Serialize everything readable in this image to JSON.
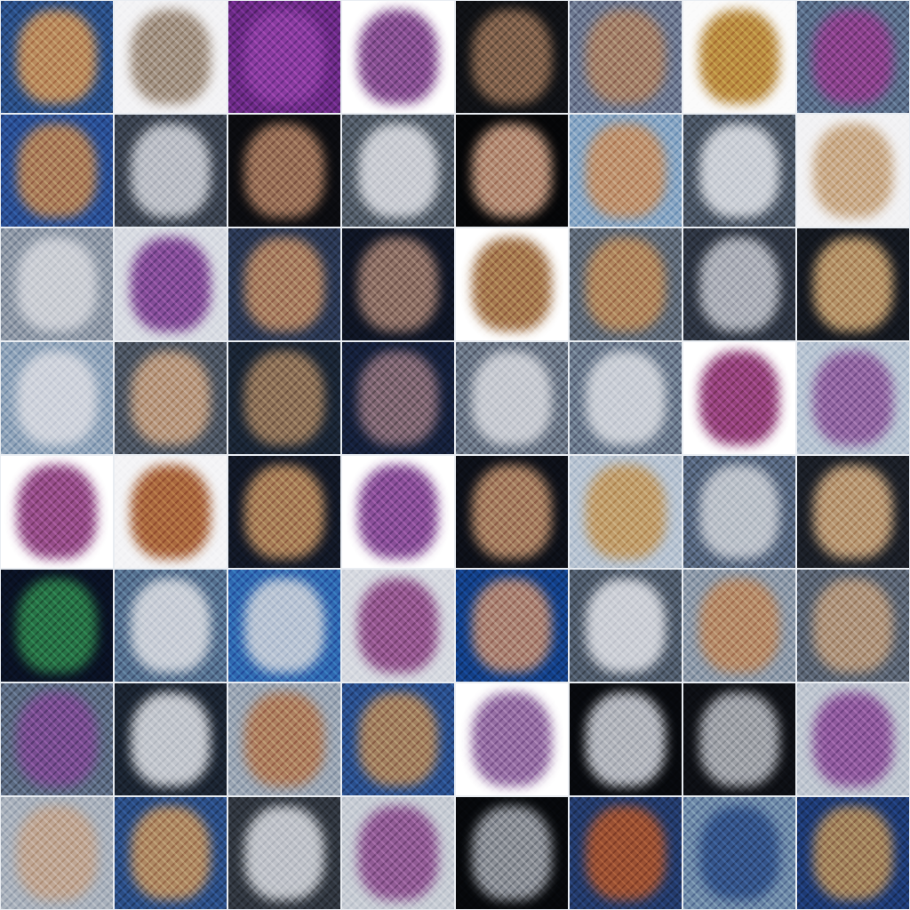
{
  "grid": {
    "rows": 8,
    "cols": 8,
    "tiles": [
      {
        "bg": "#2b4f86",
        "blob": "#c9925a"
      },
      {
        "bg": "#f3f3f5",
        "blob": "#9a8877"
      },
      {
        "bg": "#6a2a84",
        "blob": "#8d3fa3"
      },
      {
        "bg": "#ffffff",
        "blob": "#7a3e86"
      },
      {
        "bg": "#101216",
        "blob": "#8c6a52"
      },
      {
        "bg": "#6d7890",
        "blob": "#a98266"
      },
      {
        "bg": "#fbfbfb",
        "blob": "#b4822f"
      },
      {
        "bg": "#5b6f8a",
        "blob": "#8e3e8c"
      },
      {
        "bg": "#2a4f93",
        "blob": "#b88455"
      },
      {
        "bg": "#3b4350",
        "blob": "#c9ccd3"
      },
      {
        "bg": "#0b0c10",
        "blob": "#a77a5f"
      },
      {
        "bg": "#525c68",
        "blob": "#d7d9df"
      },
      {
        "bg": "#050608",
        "blob": "#c59a80"
      },
      {
        "bg": "#87a5c3",
        "blob": "#c49268"
      },
      {
        "bg": "#4a5564",
        "blob": "#dadde3"
      },
      {
        "bg": "#f2f2f4",
        "blob": "#c5a47f"
      },
      {
        "bg": "#8e98a6",
        "blob": "#d2d4da"
      },
      {
        "bg": "#d8dbe2",
        "blob": "#7b3e90"
      },
      {
        "bg": "#2a3752",
        "blob": "#b58663"
      },
      {
        "bg": "#0f1524",
        "blob": "#9b7a6d"
      },
      {
        "bg": "#ffffff",
        "blob": "#9d6c3e"
      },
      {
        "bg": "#5f6a78",
        "blob": "#b88a5c"
      },
      {
        "bg": "#2e3542",
        "blob": "#b9bcc4"
      },
      {
        "bg": "#141820",
        "blob": "#c6a070"
      },
      {
        "bg": "#8fa3b9",
        "blob": "#d7d9e0"
      },
      {
        "bg": "#4c5562",
        "blob": "#c3a083"
      },
      {
        "bg": "#1a2534",
        "blob": "#9a7a5c"
      },
      {
        "bg": "#15203a",
        "blob": "#8a6e78"
      },
      {
        "bg": "#6b7686",
        "blob": "#d2d4da"
      },
      {
        "bg": "#6c7a8d",
        "blob": "#d5d8de"
      },
      {
        "bg": "#ffffff",
        "blob": "#8a2f6e"
      },
      {
        "bg": "#b8c4d2",
        "blob": "#8d5c9c"
      },
      {
        "bg": "#ffffff",
        "blob": "#8a3a7c"
      },
      {
        "bg": "#f4f4f6",
        "blob": "#a35a2c"
      },
      {
        "bg": "#121826",
        "blob": "#b88a5e"
      },
      {
        "bg": "#ffffff",
        "blob": "#7d3d8d"
      },
      {
        "bg": "#0d1018",
        "blob": "#b58968"
      },
      {
        "bg": "#b7c3d1",
        "blob": "#c29a62"
      },
      {
        "bg": "#56667e",
        "blob": "#c7cbd2"
      },
      {
        "bg": "#1b1f27",
        "blob": "#c8a47c"
      },
      {
        "bg": "#0a1224",
        "blob": "#2c7d4a"
      },
      {
        "bg": "#55708f",
        "blob": "#d6d9df"
      },
      {
        "bg": "#2f68b0",
        "blob": "#c9cfd8"
      },
      {
        "bg": "#d6d9e0",
        "blob": "#8c4a86"
      },
      {
        "bg": "#133f86",
        "blob": "#bb8b73"
      },
      {
        "bg": "#4f5b6b",
        "blob": "#dadce2"
      },
      {
        "bg": "#8d99a8",
        "blob": "#ba8a63"
      },
      {
        "bg": "#5a6473",
        "blob": "#b89a7e"
      },
      {
        "bg": "#5c6b82",
        "blob": "#7c4a92"
      },
      {
        "bg": "#1b2431",
        "blob": "#d5d8de"
      },
      {
        "bg": "#9aa5b3",
        "blob": "#b07c58"
      },
      {
        "bg": "#2a4f8c",
        "blob": "#b0865c"
      },
      {
        "bg": "#ffffff",
        "blob": "#8a5f9a"
      },
      {
        "bg": "#07090d",
        "blob": "#c5c8d0"
      },
      {
        "bg": "#0d0f14",
        "blob": "#aeb1b8"
      },
      {
        "bg": "#bfc6d0",
        "blob": "#8a4f98"
      },
      {
        "bg": "#a9b1bc",
        "blob": "#c2a58f"
      },
      {
        "bg": "#2b4d84",
        "blob": "#bd9060"
      },
      {
        "bg": "#30363f",
        "blob": "#cfd2d8"
      },
      {
        "bg": "#c7ccd4",
        "blob": "#8b4f8e"
      },
      {
        "bg": "#06080b",
        "blob": "#9a9ea6"
      },
      {
        "bg": "#233a6a",
        "blob": "#a8542e"
      },
      {
        "bg": "#6f8aa8",
        "blob": "#2f4f86"
      },
      {
        "bg": "#1e3a73",
        "blob": "#b08a5a"
      }
    ]
  }
}
